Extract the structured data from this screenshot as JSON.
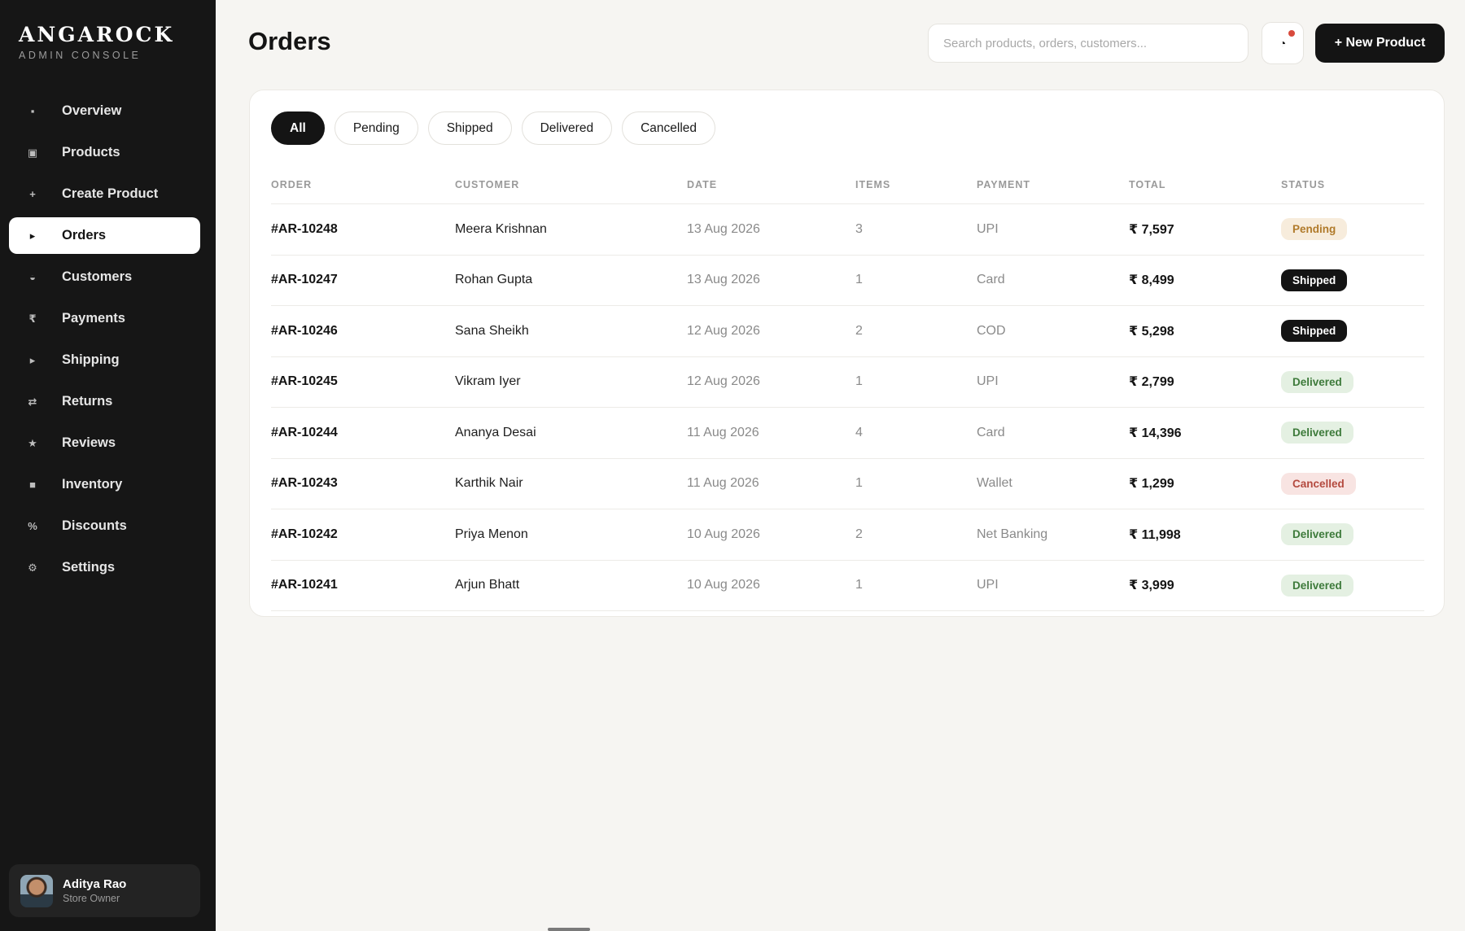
{
  "brand": {
    "name": "ANGAROCK",
    "subtitle": "ADMIN CONSOLE"
  },
  "sidebar": {
    "items": [
      {
        "label": "Overview",
        "icon": "▪",
        "icon_name": "overview-icon",
        "active": false
      },
      {
        "label": "Products",
        "icon": "▣",
        "icon_name": "products-icon",
        "active": false
      },
      {
        "label": "Create Product",
        "icon": "+",
        "icon_name": "plus-icon",
        "active": false
      },
      {
        "label": "Orders",
        "icon": "▸",
        "icon_name": "orders-icon",
        "active": true
      },
      {
        "label": "Customers",
        "icon": "◒",
        "icon_name": "customers-icon",
        "active": false
      },
      {
        "label": "Payments",
        "icon": "₹",
        "icon_name": "rupee-icon",
        "active": false
      },
      {
        "label": "Shipping",
        "icon": "▸",
        "icon_name": "shipping-icon",
        "active": false
      },
      {
        "label": "Returns",
        "icon": "⇄",
        "icon_name": "returns-icon",
        "active": false
      },
      {
        "label": "Reviews",
        "icon": "★",
        "icon_name": "star-icon",
        "active": false
      },
      {
        "label": "Inventory",
        "icon": "■",
        "icon_name": "inventory-icon",
        "active": false
      },
      {
        "label": "Discounts",
        "icon": "%",
        "icon_name": "percent-icon",
        "active": false
      },
      {
        "label": "Settings",
        "icon": "⚙",
        "icon_name": "gear-icon",
        "active": false
      }
    ]
  },
  "user": {
    "name": "Aditya Rao",
    "role": "Store Owner"
  },
  "header": {
    "title": "Orders",
    "search_placeholder": "Search products, orders, customers...",
    "notification_icon": "◔",
    "new_product_label": "+ New Product"
  },
  "filters": {
    "tabs": [
      "All",
      "Pending",
      "Shipped",
      "Delivered",
      "Cancelled"
    ],
    "selected": "All"
  },
  "table": {
    "columns": [
      "ORDER",
      "CUSTOMER",
      "DATE",
      "ITEMS",
      "PAYMENT",
      "TOTAL",
      "STATUS"
    ],
    "rows": [
      {
        "order": "#AR-10248",
        "customer": "Meera Krishnan",
        "date": "13 Aug 2026",
        "items": "3",
        "payment": "UPI",
        "total": "₹ 7,597",
        "status": "Pending"
      },
      {
        "order": "#AR-10247",
        "customer": "Rohan Gupta",
        "date": "13 Aug 2026",
        "items": "1",
        "payment": "Card",
        "total": "₹ 8,499",
        "status": "Shipped"
      },
      {
        "order": "#AR-10246",
        "customer": "Sana Sheikh",
        "date": "12 Aug 2026",
        "items": "2",
        "payment": "COD",
        "total": "₹ 5,298",
        "status": "Shipped"
      },
      {
        "order": "#AR-10245",
        "customer": "Vikram Iyer",
        "date": "12 Aug 2026",
        "items": "1",
        "payment": "UPI",
        "total": "₹ 2,799",
        "status": "Delivered"
      },
      {
        "order": "#AR-10244",
        "customer": "Ananya Desai",
        "date": "11 Aug 2026",
        "items": "4",
        "payment": "Card",
        "total": "₹ 14,396",
        "status": "Delivered"
      },
      {
        "order": "#AR-10243",
        "customer": "Karthik Nair",
        "date": "11 Aug 2026",
        "items": "1",
        "payment": "Wallet",
        "total": "₹ 1,299",
        "status": "Cancelled"
      },
      {
        "order": "#AR-10242",
        "customer": "Priya Menon",
        "date": "10 Aug 2026",
        "items": "2",
        "payment": "Net Banking",
        "total": "₹ 11,998",
        "status": "Delivered"
      },
      {
        "order": "#AR-10241",
        "customer": "Arjun Bhatt",
        "date": "10 Aug 2026",
        "items": "1",
        "payment": "UPI",
        "total": "₹ 3,999",
        "status": "Delivered"
      }
    ]
  },
  "colors": {
    "sidebar_bg": "#161616",
    "page_bg": "#f6f5f2",
    "accent": "#141414",
    "pending": "#b07a2a",
    "delivered": "#3d7a3a",
    "cancelled": "#b44a3f",
    "notification_dot": "#d84a3c"
  }
}
